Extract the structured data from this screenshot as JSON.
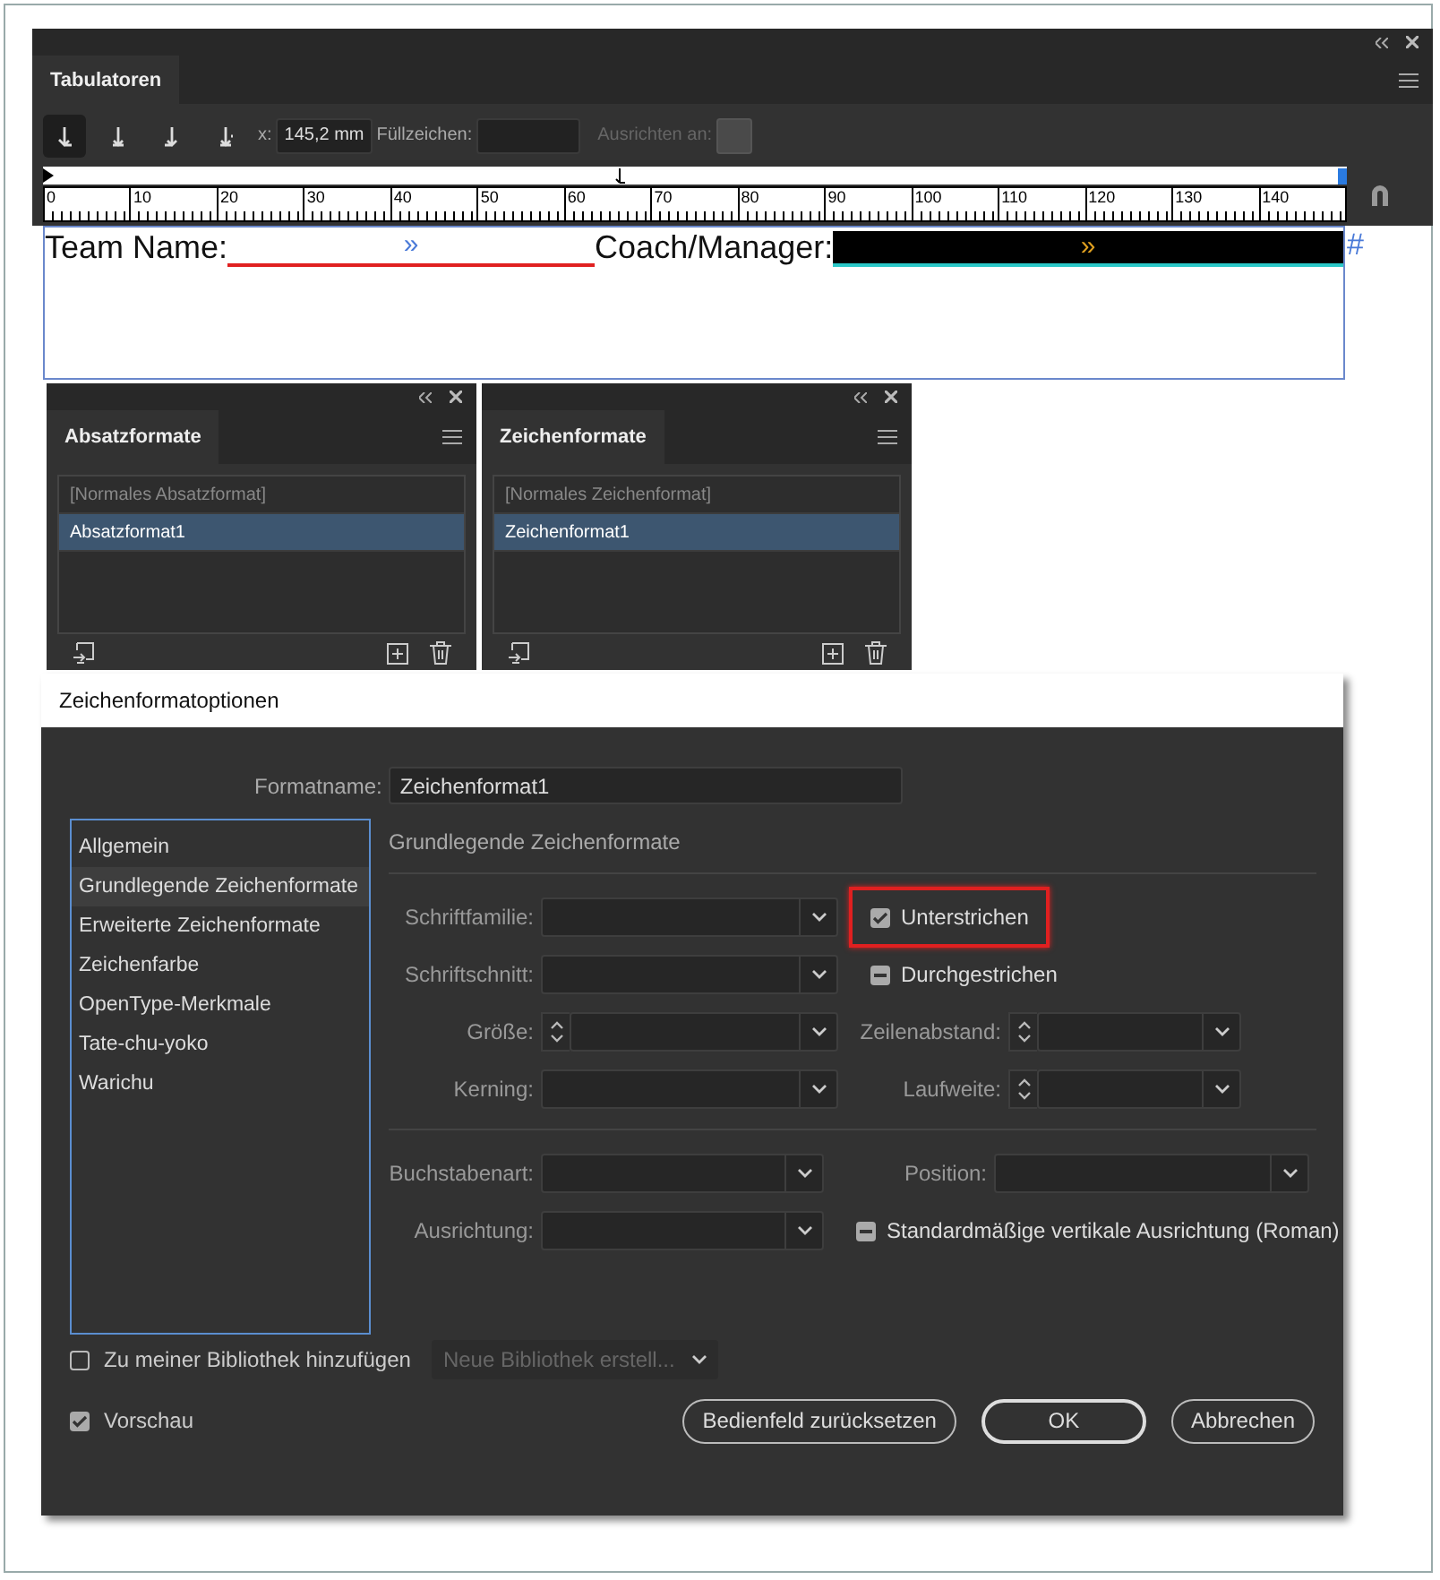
{
  "tab_panel": {
    "title": "Tabulatoren",
    "tab_buttons": [
      {
        "kind": "left",
        "selected": true
      },
      {
        "kind": "center",
        "selected": false
      },
      {
        "kind": "right",
        "selected": false
      },
      {
        "kind": "decimal",
        "selected": false
      }
    ],
    "x_label": "x:",
    "x_value": "145,2 mm",
    "leader_label": "Füllzeichen:",
    "align_label": "Ausrichten an:",
    "ruler_labels": [
      "0",
      "10",
      "20",
      "30",
      "40",
      "50",
      "60",
      "70",
      "80",
      "90",
      "100",
      "110",
      "120",
      "130",
      "140"
    ]
  },
  "document": {
    "team_label": "Team Name:",
    "team_tab_mark": "»",
    "coach_label": "Coach/Manager:",
    "coach_tab_mark": "»",
    "end_mark": "#"
  },
  "style_panels": [
    {
      "title": "Absatzformate",
      "items": [
        {
          "label": "[Normales Absatzformat]",
          "selected": false
        },
        {
          "label": "Absatzformat1",
          "selected": true
        }
      ]
    },
    {
      "title": "Zeichenformate",
      "items": [
        {
          "label": "[Normales Zeichenformat]",
          "selected": false
        },
        {
          "label": "Zeichenformat1",
          "selected": true
        }
      ]
    }
  ],
  "dialog": {
    "title": "Zeichenformatoptionen",
    "format_name_label": "Formatname:",
    "format_name": "Zeichenformat1",
    "categories": [
      {
        "label": "Allgemein",
        "selected": false
      },
      {
        "label": "Grundlegende Zeichenformate",
        "selected": true
      },
      {
        "label": "Erweiterte Zeichenformate",
        "selected": false
      },
      {
        "label": "Zeichenfarbe",
        "selected": false
      },
      {
        "label": "OpenType-Merkmale",
        "selected": false
      },
      {
        "label": "Tate-chu-yoko",
        "selected": false
      },
      {
        "label": "Warichu",
        "selected": false
      }
    ],
    "section_title": "Grundlegende Zeichenformate",
    "groups": [
      {
        "rows": [
          [
            {
              "kind": "select",
              "label": "Schriftfamilie:"
            },
            {
              "kind": "checkbox",
              "label": "Unterstrichen",
              "checked": true,
              "highlighted": true
            }
          ],
          [
            {
              "kind": "select",
              "label": "Schriftschnitt:"
            },
            {
              "kind": "checkbox",
              "label": "Durchgestrichen",
              "mixed": true
            }
          ],
          [
            {
              "kind": "spinner",
              "label": "Größe:"
            },
            {
              "kind": "spinner",
              "label": "Zeilenabstand:"
            }
          ],
          [
            {
              "kind": "select",
              "label": "Kerning:"
            },
            {
              "kind": "spinner",
              "label": "Laufweite:"
            }
          ]
        ]
      },
      {
        "rows": [
          [
            {
              "kind": "select",
              "label": "Buchstabenart:"
            },
            {
              "kind": "select",
              "label": "Position:"
            }
          ],
          [
            {
              "kind": "select",
              "label": "Ausrichtung:"
            },
            {
              "kind": "checkbox",
              "label": "Standardmäßige vertikale Ausrichtung (Roman)",
              "mixed": true
            }
          ]
        ]
      }
    ],
    "library_checkbox": {
      "label": "Zu meiner Bibliothek hinzufügen",
      "checked": false
    },
    "library_select": {
      "value": "Neue Bibliothek erstell...",
      "disabled": true
    },
    "preview_checkbox": {
      "label": "Vorschau",
      "checked": true
    },
    "buttons": [
      {
        "label": "Bedienfeld zurücksetzen",
        "kind": "normal"
      },
      {
        "label": "OK",
        "kind": "default"
      },
      {
        "label": "Abbrechen",
        "kind": "normal"
      }
    ]
  }
}
